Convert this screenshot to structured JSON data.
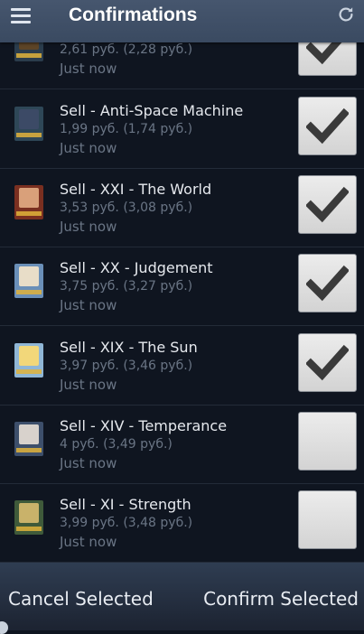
{
  "header": {
    "title": "Confirmations",
    "menu_icon": "hamburger-menu-icon",
    "refresh_icon": "refresh-icon"
  },
  "items": [
    {
      "name": "",
      "price": "2,61 руб. (2,28 руб.)",
      "time": "Just now",
      "checked": true,
      "thumb": {
        "bg": "#2a3c4c",
        "inner": "#5c4427"
      }
    },
    {
      "name": "Sell - Anti-Space Machine",
      "price": "1,99 руб. (1,74 руб.)",
      "time": "Just now",
      "checked": true,
      "thumb": {
        "bg": "#2e4757",
        "inner": "#3c4a66"
      }
    },
    {
      "name": "Sell - XXI - The World",
      "price": "3,53 руб. (3,08 руб.)",
      "time": "Just now",
      "checked": true,
      "thumb": {
        "bg": "#7a2f20",
        "inner": "#d9a07a"
      }
    },
    {
      "name": "Sell - XX - Judgement",
      "price": "3,75 руб. (3,27 руб.)",
      "time": "Just now",
      "checked": true,
      "thumb": {
        "bg": "#6a8fb8",
        "inner": "#e8ddc8"
      }
    },
    {
      "name": "Sell - XIX - The Sun",
      "price": "3,97 руб. (3,46 руб.)",
      "time": "Just now",
      "checked": true,
      "thumb": {
        "bg": "#8fb6d6",
        "inner": "#f2d77a"
      }
    },
    {
      "name": "Sell - XIV - Temperance",
      "price": "4 руб. (3,49 руб.)",
      "time": "Just now",
      "checked": false,
      "thumb": {
        "bg": "#3d4f6b",
        "inner": "#d8d2cc"
      }
    },
    {
      "name": "Sell - XI - Strength",
      "price": "3,99 руб. (3,48 руб.)",
      "time": "Just now",
      "checked": false,
      "thumb": {
        "bg": "#3f5a3a",
        "inner": "#c9b26a"
      }
    }
  ],
  "footer": {
    "cancel_label": "Cancel Selected",
    "confirm_label": "Confirm Selected"
  },
  "colors": {
    "header_bg": "#3e4e66",
    "list_bg": "#0f1520",
    "checkmark": "#3a3a3a",
    "footer_text": "#e8ecf2"
  }
}
